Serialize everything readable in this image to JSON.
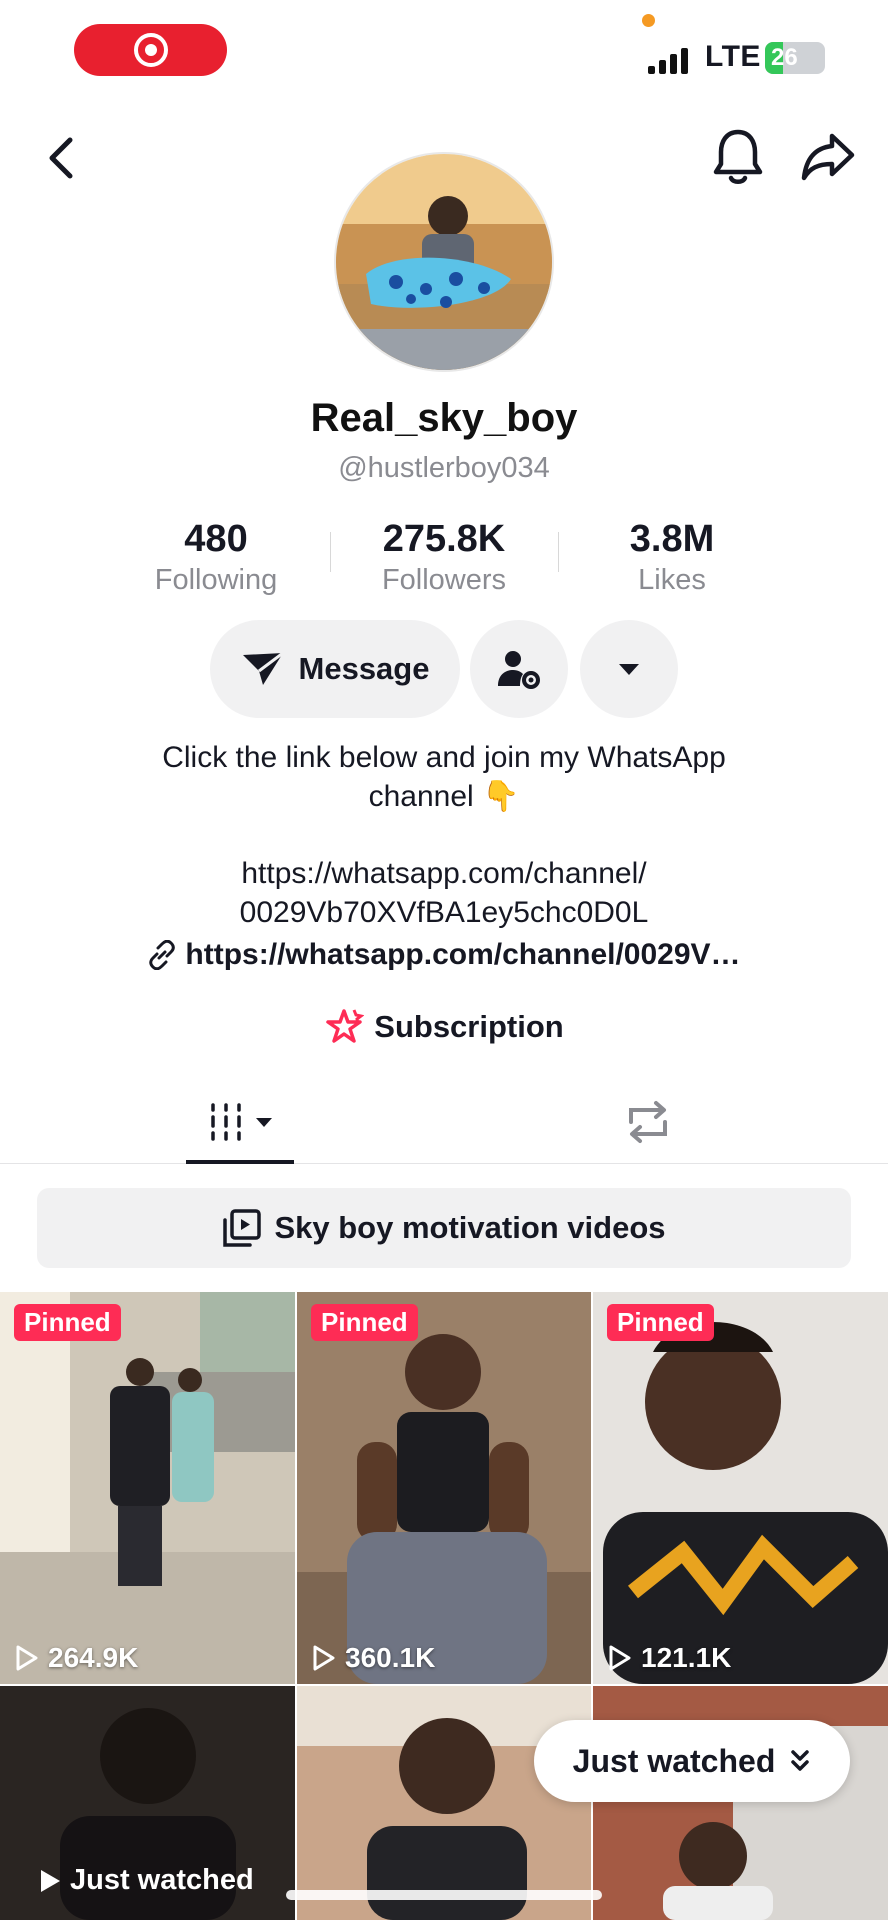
{
  "status_bar": {
    "network": "LTE",
    "battery": "26"
  },
  "profile": {
    "display_name": "Real_sky_boy",
    "handle": "@hustlerboy034"
  },
  "stats": {
    "following": {
      "value": "480",
      "label": "Following"
    },
    "followers": {
      "value": "275.8K",
      "label": "Followers"
    },
    "likes": {
      "value": "3.8M",
      "label": "Likes"
    }
  },
  "actions": {
    "message_label": "Message"
  },
  "bio": {
    "line1": "Click the link below and join my WhatsApp",
    "line2": "channel 👇",
    "link_line1": "https://whatsapp.com/channel/",
    "link_line2": "0029Vb70XVfBA1ey5chc0D0L",
    "url": "https://whatsapp.com/channel/0029V…",
    "subscription": "Subscription"
  },
  "playlist": {
    "label": "Sky boy motivation videos"
  },
  "videos": [
    {
      "pinned": "Pinned",
      "views": "264.9K"
    },
    {
      "pinned": "Pinned",
      "views": "360.1K"
    },
    {
      "pinned": "Pinned",
      "views": "121.1K"
    }
  ],
  "just_watched": {
    "tile_label": "Just watched",
    "button_label": "Just watched"
  },
  "colors": {
    "accent": "#fe2c55",
    "record": "#e8202f",
    "text": "#161823",
    "muted": "#8a8b91"
  }
}
